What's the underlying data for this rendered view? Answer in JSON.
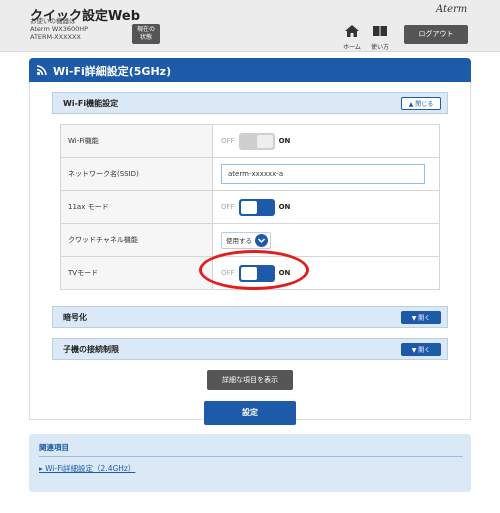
{
  "header": {
    "app_title": "クイック設定Web",
    "device_lines": [
      "お使いの機器は",
      "Aterm WX3600HP",
      "ATERM-XXXXXX"
    ],
    "status_button": [
      "現在の",
      "状態"
    ],
    "brand": "Aterm",
    "nav": [
      {
        "label": "ホーム",
        "icon": "home-icon"
      },
      {
        "label": "使い方",
        "icon": "book-icon"
      }
    ],
    "logout_label": "ログアウト"
  },
  "section": {
    "title": "Wi-Fi詳細設定(5GHz)",
    "icon": "wifi-icon"
  },
  "wifi_panel": {
    "title": "Wi-Fi機能設定",
    "toggle_label": "閉じる"
  },
  "rows": [
    {
      "label": "Wi-Fi機能",
      "type": "toggle",
      "off": "OFF",
      "on": "ON",
      "state": "inactive"
    },
    {
      "label": "ネットワーク名(SSID)",
      "type": "input",
      "value": "aterm-xxxxxx-a"
    },
    {
      "label": "11ax モード",
      "type": "toggle",
      "off": "OFF",
      "on": "ON",
      "state": "on"
    },
    {
      "label": "クワッドチャネル機能",
      "type": "select",
      "value": "使用する"
    },
    {
      "label": "TVモード",
      "type": "toggle",
      "off": "OFF",
      "on": "ON",
      "state": "on"
    }
  ],
  "encryption_panel": {
    "title": "暗号化",
    "toggle_label": "開く"
  },
  "child_panel": {
    "title": "子機の接続制限",
    "toggle_label": "開く"
  },
  "buttons": {
    "detail": "詳細な項目を表示",
    "save": "設定"
  },
  "related": {
    "title": "関連項目",
    "link": "Wi-Fi詳細設定（2.4GHz）"
  },
  "colors": {
    "accent": "#1d5aa7",
    "highlight": "#e51c1c",
    "panel_bg": "#dbe9f7"
  }
}
